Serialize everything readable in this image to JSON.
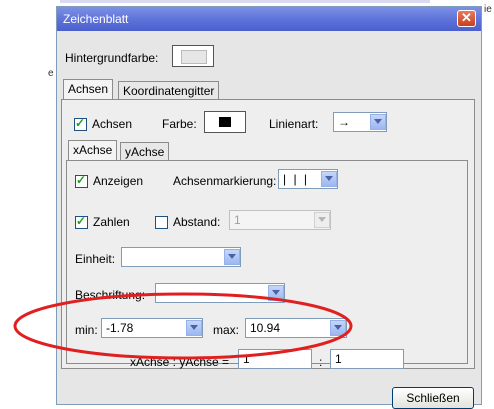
{
  "background": {
    "glyph_e": "e",
    "glyph_e2": "e",
    "glyph_ie": "ie"
  },
  "dialog": {
    "title": "Zeichenblatt",
    "close_glyph": "✕",
    "background_color_label": "Hintergrundfarbe:",
    "background_color": "#e6e6e6",
    "tabs": [
      "Achsen",
      "Koordinatengitter"
    ],
    "active_tab": "Achsen",
    "axes": {
      "show_label": "Achsen",
      "show_checked": true,
      "color_label": "Farbe:",
      "color": "#000000",
      "linetype_label": "Linienart:",
      "linetype_value": "→"
    },
    "axis_tabs": [
      "xAchse",
      "yAchse"
    ],
    "active_axis_tab": "xAchse",
    "xaxis": {
      "show_label": "Anzeigen",
      "show_checked": true,
      "ticks_label": "Achsenmarkierung:",
      "ticks_value": "|  |  |",
      "numbers_label": "Zahlen",
      "numbers_checked": true,
      "distance_label": "Abstand:",
      "distance_checked": false,
      "distance_value": "1",
      "unit_label": "Einheit:",
      "unit_value": "",
      "caption_label": "Beschriftung:",
      "caption_value": "",
      "min_label": "min:",
      "min_value": "-1.78",
      "max_label": "max:",
      "max_value": "10.94"
    },
    "ratio": {
      "label": "xAchse : yAchse =",
      "x_value": "1",
      "separator": ":",
      "y_value": "1"
    },
    "close_button": "Schließen",
    "highlight_color": "#e02020"
  }
}
